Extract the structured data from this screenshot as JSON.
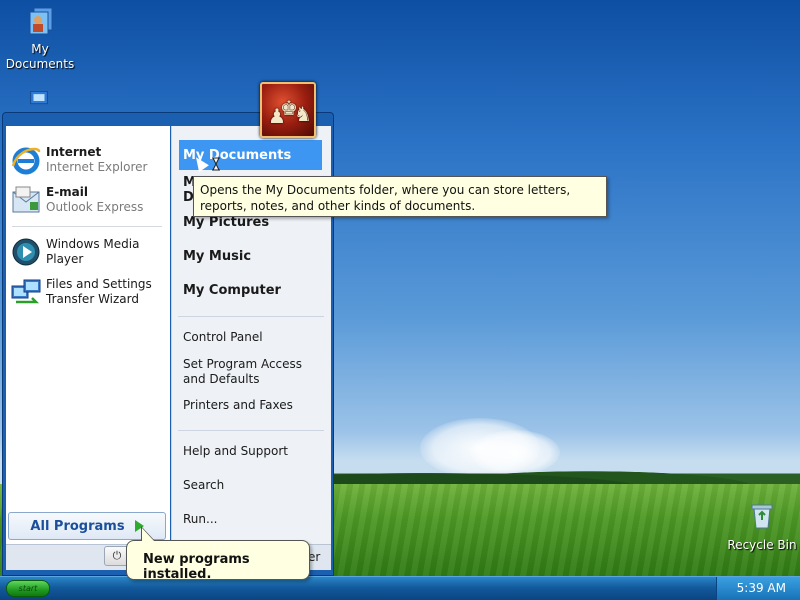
{
  "desktop": {
    "icons": [
      {
        "label": "My Documents"
      },
      {
        "label": "Recycle Bin"
      }
    ]
  },
  "start_menu": {
    "pinned": [
      {
        "title": "Internet",
        "subtitle": "Internet Explorer",
        "icon": "internet-explorer-icon"
      },
      {
        "title": "E-mail",
        "subtitle": "Outlook Express",
        "icon": "outlook-express-icon"
      }
    ],
    "recent": [
      {
        "label": "Windows Media Player",
        "icon": "windows-media-player-icon"
      },
      {
        "label": "Files and Settings Transfer Wizard",
        "icon": "transfer-wizard-icon"
      }
    ],
    "all_programs": "All Programs",
    "places": {
      "my_documents": "My Documents",
      "frag_m": "M",
      "frag_d": "D",
      "my_pictures": "My Pictures",
      "my_music": "My Music",
      "my_computer": "My Computer"
    },
    "system": {
      "control_panel": "Control Panel",
      "set_program_access": "Set Program Access and Defaults",
      "printers_faxes": "Printers and Faxes",
      "help_support": "Help and Support",
      "search": "Search",
      "run": "Run..."
    },
    "bottom": {
      "power_glyph": "⏻",
      "switch_frag": "er"
    }
  },
  "tooltip": {
    "text": "Opens the My Documents folder, where you can store letters, reports, notes, and other kinds of documents."
  },
  "balloon": {
    "text": "New programs installed."
  },
  "taskbar": {
    "start_label": "start",
    "clock": "5:39 AM"
  },
  "colors": {
    "highlight": "#3d96f2",
    "tooltip_bg": "#ffffe1",
    "taskbar": "#135a9c"
  }
}
